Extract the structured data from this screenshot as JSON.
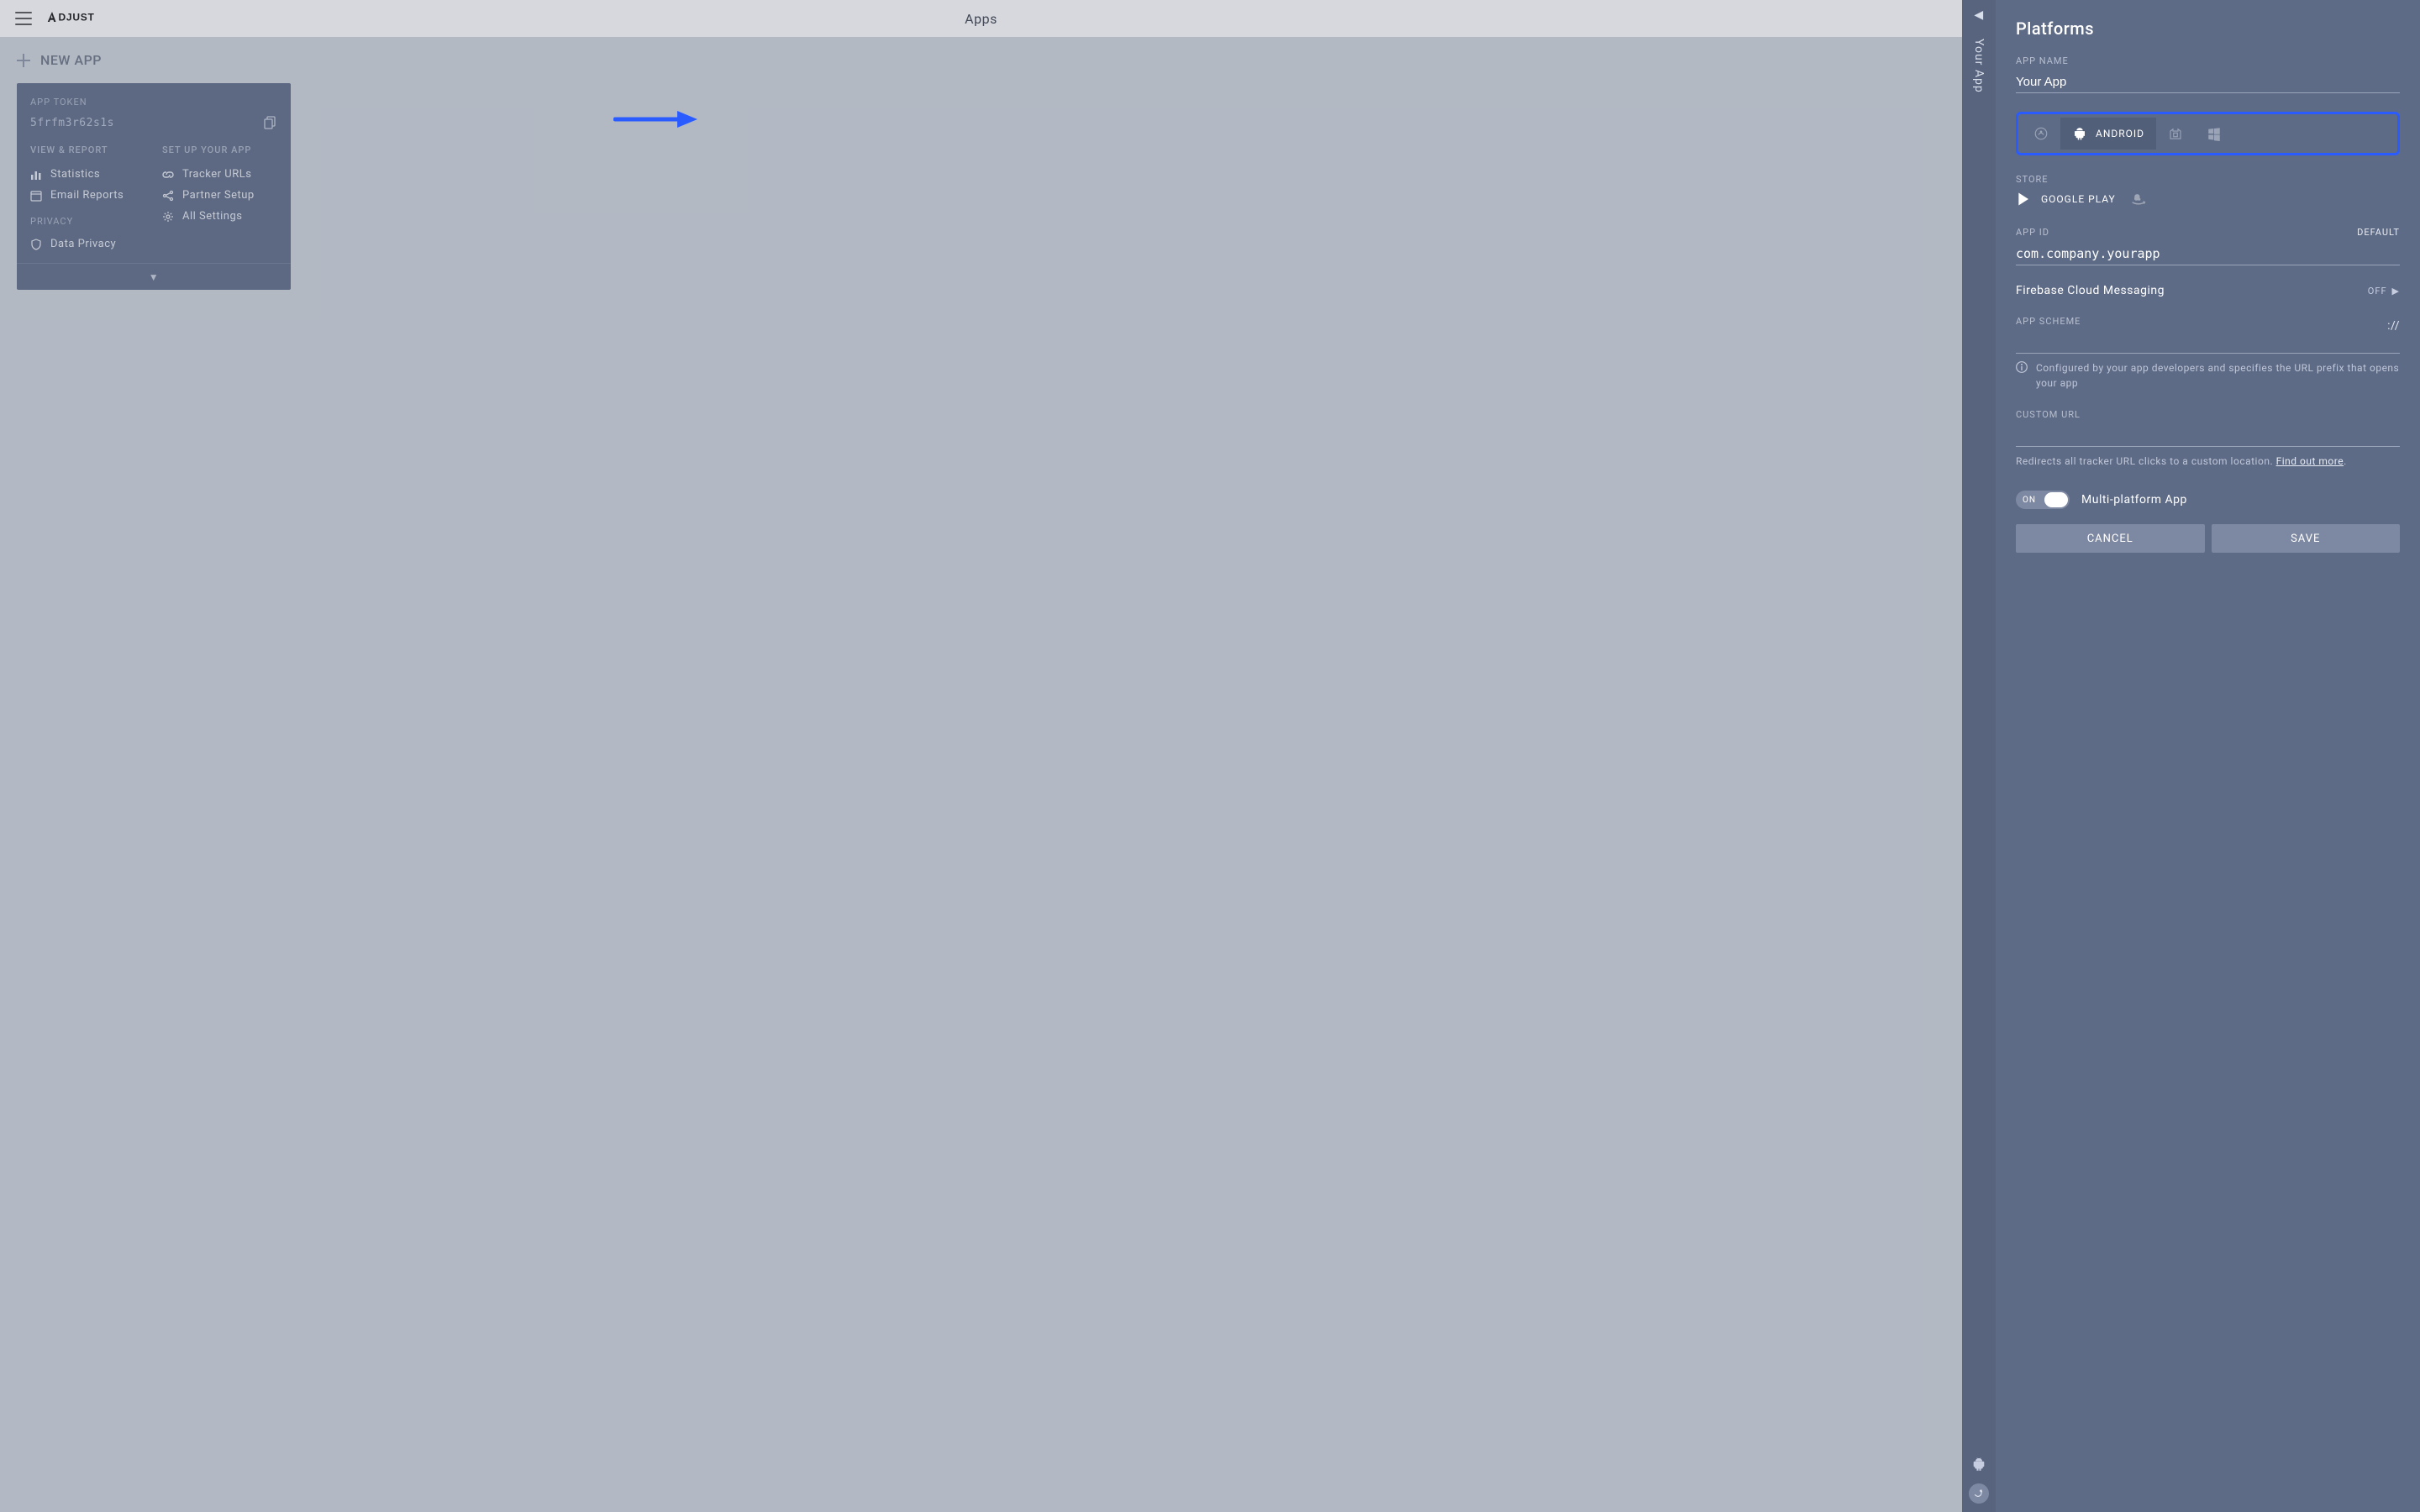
{
  "header": {
    "title": "Apps",
    "brand": "ADJUST"
  },
  "newapp": {
    "label": "NEW APP"
  },
  "card": {
    "token_label": "APP TOKEN",
    "token": "5frfm3r62s1s",
    "view_label": "VIEW & REPORT",
    "setup_label": "SET UP YOUR APP",
    "links_view": [
      "Statistics",
      "Email Reports"
    ],
    "links_setup": [
      "Tracker URLs",
      "Partner Setup",
      "All Settings"
    ],
    "privacy_label": "PRIVACY",
    "privacy_link": "Data Privacy"
  },
  "rail": {
    "tab": "Your App"
  },
  "panel": {
    "title": "Platforms",
    "appname_label": "APP NAME",
    "appname_value": "Your App",
    "platform_android": "ANDROID",
    "store_label": "STORE",
    "store_google": "GOOGLE PLAY",
    "appid_label": "APP ID",
    "appid_default": "DEFAULT",
    "appid_value": "com.company.yourapp",
    "fcm_label": "Firebase Cloud Messaging",
    "fcm_state": "OFF",
    "appscheme_label": "APP SCHEME",
    "appscheme_suffix": "://",
    "appscheme_help": "Configured by your app developers and specifies the URL prefix that opens your app",
    "customurl_label": "CUSTOM URL",
    "customurl_help1": "Redirects all tracker URL clicks to a custom location.",
    "customurl_help2": "Find out more",
    "toggle_on": "ON",
    "toggle_label": "Multi-platform App",
    "cancel": "CANCEL",
    "save": "SAVE"
  }
}
